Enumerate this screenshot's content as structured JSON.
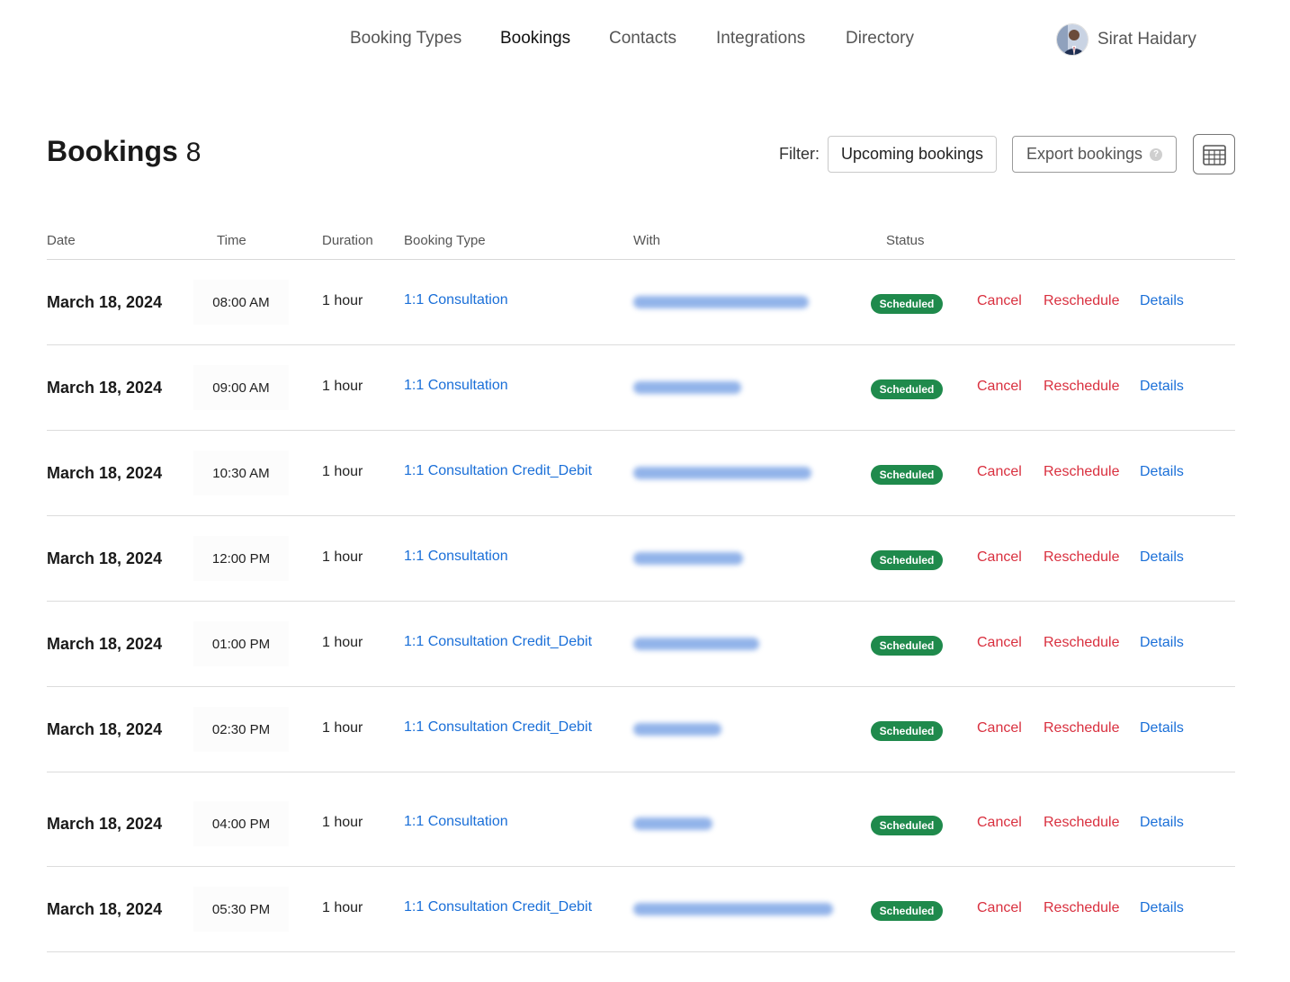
{
  "nav": {
    "items": [
      {
        "label": "Booking Types",
        "active": false
      },
      {
        "label": "Bookings",
        "active": true
      },
      {
        "label": "Contacts",
        "active": false
      },
      {
        "label": "Integrations",
        "active": false
      },
      {
        "label": "Directory",
        "active": false
      }
    ],
    "user_name": "Sirat Haidary"
  },
  "header": {
    "title": "Bookings",
    "count": "8",
    "filter_label": "Filter:",
    "filter_value": "Upcoming bookings",
    "export_label": "Export bookings",
    "export_help": "?"
  },
  "table": {
    "columns": [
      "Date",
      "Time",
      "Duration",
      "Booking Type",
      "With",
      "Status"
    ],
    "rows": [
      {
        "date": "March 18, 2024",
        "time": "08:00 AM",
        "duration": "1 hour",
        "booking_type": "1:1 Consultation",
        "status": "Scheduled",
        "cancel": "Cancel",
        "reschedule": "Reschedule",
        "details": "Details"
      },
      {
        "date": "March 18, 2024",
        "time": "09:00 AM",
        "duration": "1 hour",
        "booking_type": "1:1 Consultation",
        "status": "Scheduled",
        "cancel": "Cancel",
        "reschedule": "Reschedule",
        "details": "Details"
      },
      {
        "date": "March 18, 2024",
        "time": "10:30 AM",
        "duration": "1 hour",
        "booking_type": "1:1 Consultation Credit_Debit",
        "status": "Scheduled",
        "cancel": "Cancel",
        "reschedule": "Reschedule",
        "details": "Details"
      },
      {
        "date": "March 18, 2024",
        "time": "12:00 PM",
        "duration": "1 hour",
        "booking_type": "1:1 Consultation",
        "status": "Scheduled",
        "cancel": "Cancel",
        "reschedule": "Reschedule",
        "details": "Details"
      },
      {
        "date": "March 18, 2024",
        "time": "01:00 PM",
        "duration": "1 hour",
        "booking_type": "1:1 Consultation Credit_Debit",
        "status": "Scheduled",
        "cancel": "Cancel",
        "reschedule": "Reschedule",
        "details": "Details"
      },
      {
        "date": "March 18, 2024",
        "time": "02:30 PM",
        "duration": "1 hour",
        "booking_type": "1:1 Consultation Credit_Debit",
        "status": "Scheduled",
        "cancel": "Cancel",
        "reschedule": "Reschedule",
        "details": "Details"
      },
      {
        "date": "March 18, 2024",
        "time": "04:00 PM",
        "duration": "1 hour",
        "booking_type": "1:1 Consultation",
        "status": "Scheduled",
        "cancel": "Cancel",
        "reschedule": "Reschedule",
        "details": "Details"
      },
      {
        "date": "March 18, 2024",
        "time": "05:30 PM",
        "duration": "1 hour",
        "booking_type": "1:1 Consultation Credit_Debit",
        "status": "Scheduled",
        "cancel": "Cancel",
        "reschedule": "Reschedule",
        "details": "Details"
      }
    ]
  },
  "colors": {
    "link_blue": "#1a6fd8",
    "danger_red": "#d9303f",
    "status_green": "#1f8a4c"
  }
}
